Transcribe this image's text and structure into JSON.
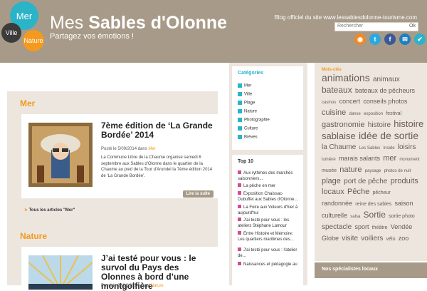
{
  "header": {
    "logo": {
      "mer": "Mer",
      "ville": "Ville",
      "nature": "Nature"
    },
    "title_prefix": "Mes",
    "title_main": "Sables d'Olonne",
    "tagline": "Partagez vos émotions !",
    "blog_line": "Blog officiel du site www.lessablesdolonne-tourisme.com",
    "search_placeholder": "Rechercher",
    "search_ok": "Ok",
    "social": [
      {
        "icon": "rss-icon",
        "glyph": "◉",
        "color": "#f08a24"
      },
      {
        "icon": "twitter-icon",
        "glyph": "t",
        "color": "#2aa9e0"
      },
      {
        "icon": "facebook-icon",
        "glyph": "f",
        "color": "#3b5998"
      },
      {
        "icon": "email-icon",
        "glyph": "✉",
        "color": "#1f7fc0"
      },
      {
        "icon": "delicious-icon",
        "glyph": "✔",
        "color": "#2bb3c8"
      }
    ]
  },
  "main": {
    "mer": {
      "category": "Mer",
      "title": "7ème édition de ‘La Grande Bordée’ 2014",
      "meta_prefix": "Posté le 5/09/2014 dans",
      "meta_category": "Mer",
      "excerpt": "La Commune Libre de la Chaume organise samedi 6 septembre aux Sables d'Olonne dans le quartier de la Chaume au pied de la Tour d'Arundel la 7ème édition 2014 de ‘La Grande Bordée’.",
      "read_more": "Lire la suite",
      "all_link": "Tous les articles \"Mer\""
    },
    "nature": {
      "category": "Nature",
      "title": "J’ai testé pour vous : le survol du Pays des Olonnes à bord d’une montgolfière",
      "meta_prefix": "Posté le 28/10/2014 dans",
      "meta_category": "Nature"
    }
  },
  "sidebar": {
    "categories_title": "Catégories",
    "categories": [
      "Mer",
      "Ville",
      "Plage",
      "Nature",
      "Photographie",
      "Culture",
      "Brèves"
    ],
    "top_title": "Top 10",
    "top": [
      "Aux rythmes des marchés saisonniers...",
      "La pêche en mer",
      "Exposition Chaissac-Dubuffet aux Sables d'Olonne...",
      "La Foire aux Voleurs d'hier à aujourd'hui",
      "J'ai testé pour vous : les ateliers Stéphane Lamour",
      "Entre Histoire et Mémoire: Les quartiers maritimes des...",
      "J'ai testé pour vous : l'atelier de...",
      "Naissances et pédagogie au"
    ]
  },
  "tags_panel": {
    "title": "Mots-clés",
    "tags": [
      {
        "text": "animations",
        "size": 14
      },
      {
        "text": "animaux",
        "size": 10
      },
      {
        "text": "bateaux",
        "size": 12
      },
      {
        "text": "bateaux de pêcheurs",
        "size": 9
      },
      {
        "text": "casinos",
        "size": 6
      },
      {
        "text": "concert",
        "size": 9
      },
      {
        "text": "conseils photos",
        "size": 9
      },
      {
        "text": "cuisine",
        "size": 11
      },
      {
        "text": "danse",
        "size": 6
      },
      {
        "text": "exposition",
        "size": 6
      },
      {
        "text": "festival",
        "size": 7
      },
      {
        "text": "gastronomie",
        "size": 11
      },
      {
        "text": "histoire",
        "size": 10
      },
      {
        "text": "histoire sablaise",
        "size": 13
      },
      {
        "text": "idée de sortie",
        "size": 14
      },
      {
        "text": "la Chaume",
        "size": 10
      },
      {
        "text": "Les Sables",
        "size": 6
      },
      {
        "text": "Inside",
        "size": 6
      },
      {
        "text": "loisirs",
        "size": 10
      },
      {
        "text": "lumière",
        "size": 6
      },
      {
        "text": "marais salants",
        "size": 9
      },
      {
        "text": "mer",
        "size": 11
      },
      {
        "text": "monument",
        "size": 6
      },
      {
        "text": "musée",
        "size": 7
      },
      {
        "text": "nature",
        "size": 11
      },
      {
        "text": "paysage",
        "size": 6
      },
      {
        "text": "photos de nuit",
        "size": 6
      },
      {
        "text": "plage",
        "size": 11
      },
      {
        "text": "port de pêche",
        "size": 10
      },
      {
        "text": "produits locaux",
        "size": 11
      },
      {
        "text": "Pêche",
        "size": 11
      },
      {
        "text": "pêcheur",
        "size": 7
      },
      {
        "text": "randonnée",
        "size": 9
      },
      {
        "text": "reine des sables",
        "size": 7
      },
      {
        "text": "saison",
        "size": 9
      },
      {
        "text": "culturelle",
        "size": 9
      },
      {
        "text": "salsa",
        "size": 6
      },
      {
        "text": "Sortie",
        "size": 12
      },
      {
        "text": "sortie photo",
        "size": 7
      },
      {
        "text": "spectacle",
        "size": 10
      },
      {
        "text": "sport",
        "size": 9
      },
      {
        "text": "théâtre",
        "size": 7
      },
      {
        "text": "Vendée",
        "size": 9
      },
      {
        "text": "Globe",
        "size": 9
      },
      {
        "text": "visite",
        "size": 10
      },
      {
        "text": "voiliers",
        "size": 10
      },
      {
        "text": "vélo",
        "size": 7
      },
      {
        "text": "zoo",
        "size": 9
      }
    ],
    "specialists_title": "Nos spécialistes locaux"
  }
}
